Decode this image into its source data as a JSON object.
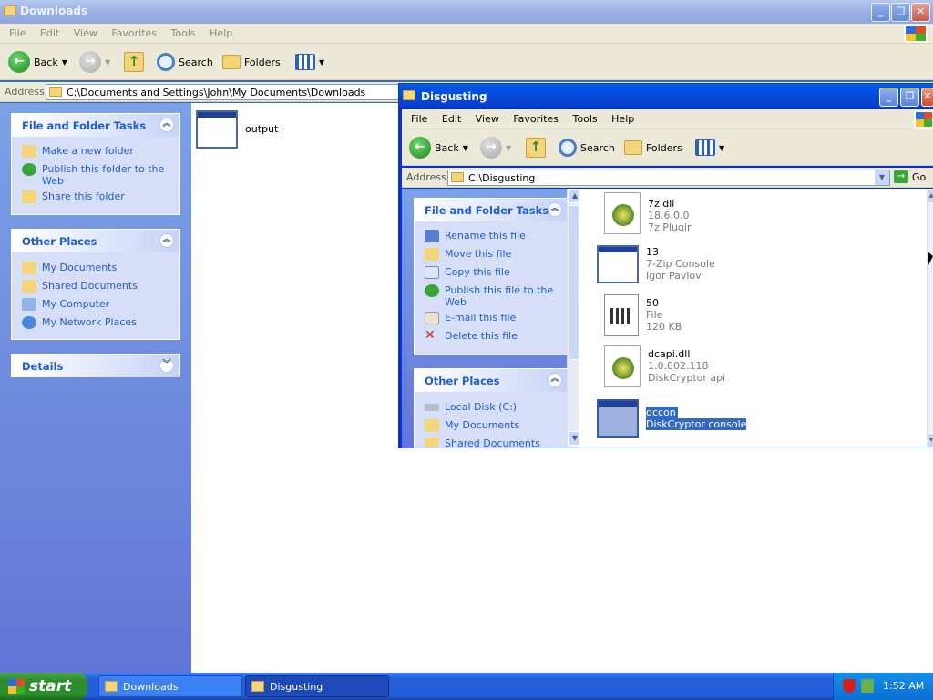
{
  "win1": {
    "title": "Downloads",
    "menu": [
      "File",
      "Edit",
      "View",
      "Favorites",
      "Tools",
      "Help"
    ],
    "toolbar": {
      "back": "Back",
      "search": "Search",
      "folders": "Folders"
    },
    "address": {
      "label": "Address",
      "value": "C:\\Documents and Settings\\John\\My Documents\\Downloads"
    },
    "tasks": {
      "title": "File and Folder Tasks",
      "items": [
        "Make a new folder",
        "Publish this folder to the Web",
        "Share this folder"
      ]
    },
    "places": {
      "title": "Other Places",
      "items": [
        "My Documents",
        "Shared Documents",
        "My Computer",
        "My Network Places"
      ]
    },
    "details": {
      "title": "Details"
    },
    "files": [
      {
        "name": "output"
      }
    ]
  },
  "win2": {
    "title": "Disgusting",
    "menu": [
      "File",
      "Edit",
      "View",
      "Favorites",
      "Tools",
      "Help"
    ],
    "toolbar": {
      "back": "Back",
      "search": "Search",
      "folders": "Folders"
    },
    "address": {
      "label": "Address",
      "value": "C:\\Disgusting",
      "go": "Go"
    },
    "tasks": {
      "title": "File and Folder Tasks",
      "items": [
        "Rename this file",
        "Move this file",
        "Copy this file",
        "Publish this file to the Web",
        "E-mail this file",
        "Delete this file"
      ]
    },
    "places": {
      "title": "Other Places",
      "items": [
        "Local Disk (C:)",
        "My Documents",
        "Shared Documents"
      ]
    },
    "files": [
      {
        "name": "7z.dll",
        "line2": "18.6.0.0",
        "line3": "7z Plugin",
        "icon": "dll-icon"
      },
      {
        "name": "13",
        "line2": "7-Zip Console",
        "line3": "Igor Pavlov",
        "icon": "app-icon"
      },
      {
        "name": "50",
        "line2": "File",
        "line3": "120 KB",
        "icon": "file-icon"
      },
      {
        "name": "dcapi.dll",
        "line2": "1.0.802.118",
        "line3": "DiskCryptor api",
        "icon": "dll-icon"
      },
      {
        "name": "dccon",
        "line2": "DiskCryptor console",
        "icon": "app-icon",
        "selected": true
      }
    ]
  },
  "taskbar": {
    "start": "start",
    "tasks": [
      "Downloads",
      "Disgusting"
    ],
    "clock": "1:52 AM"
  }
}
